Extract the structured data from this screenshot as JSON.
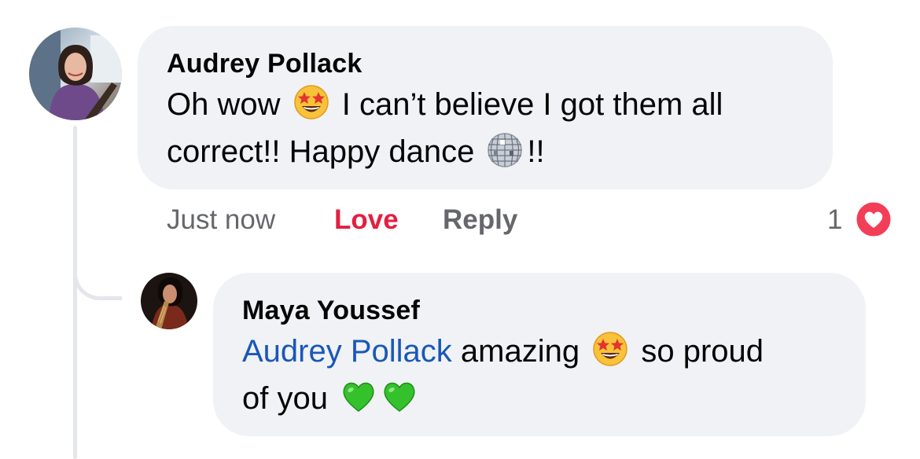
{
  "comment": {
    "author": "Audrey Pollack",
    "text_part1": "Oh wow",
    "emoji1": "star-struck-emoji",
    "text_part2": "I can’t believe I got them all",
    "text_part3": "correct!! Happy dance",
    "emoji2": "mirror-ball-emoji",
    "text_part4": "!!",
    "timestamp": "Just now",
    "love_label": "Love",
    "reply_label": "Reply",
    "reaction_count": "1",
    "reaction_icon": "heart-reaction-icon"
  },
  "reply": {
    "author": "Maya Youssef",
    "mention": "Audrey Pollack",
    "text_part1": "amazing",
    "emoji1": "star-struck-emoji",
    "text_part2": "so proud",
    "text_part3": "of you",
    "emoji2": "green-heart-emoji",
    "emoji3": "green-heart-emoji"
  },
  "colors": {
    "bubble": "#f0f2f5",
    "mention": "#1a58b8",
    "love": "#e41e3f",
    "meta": "#65676b",
    "reaction_heart": "#f33e58"
  }
}
